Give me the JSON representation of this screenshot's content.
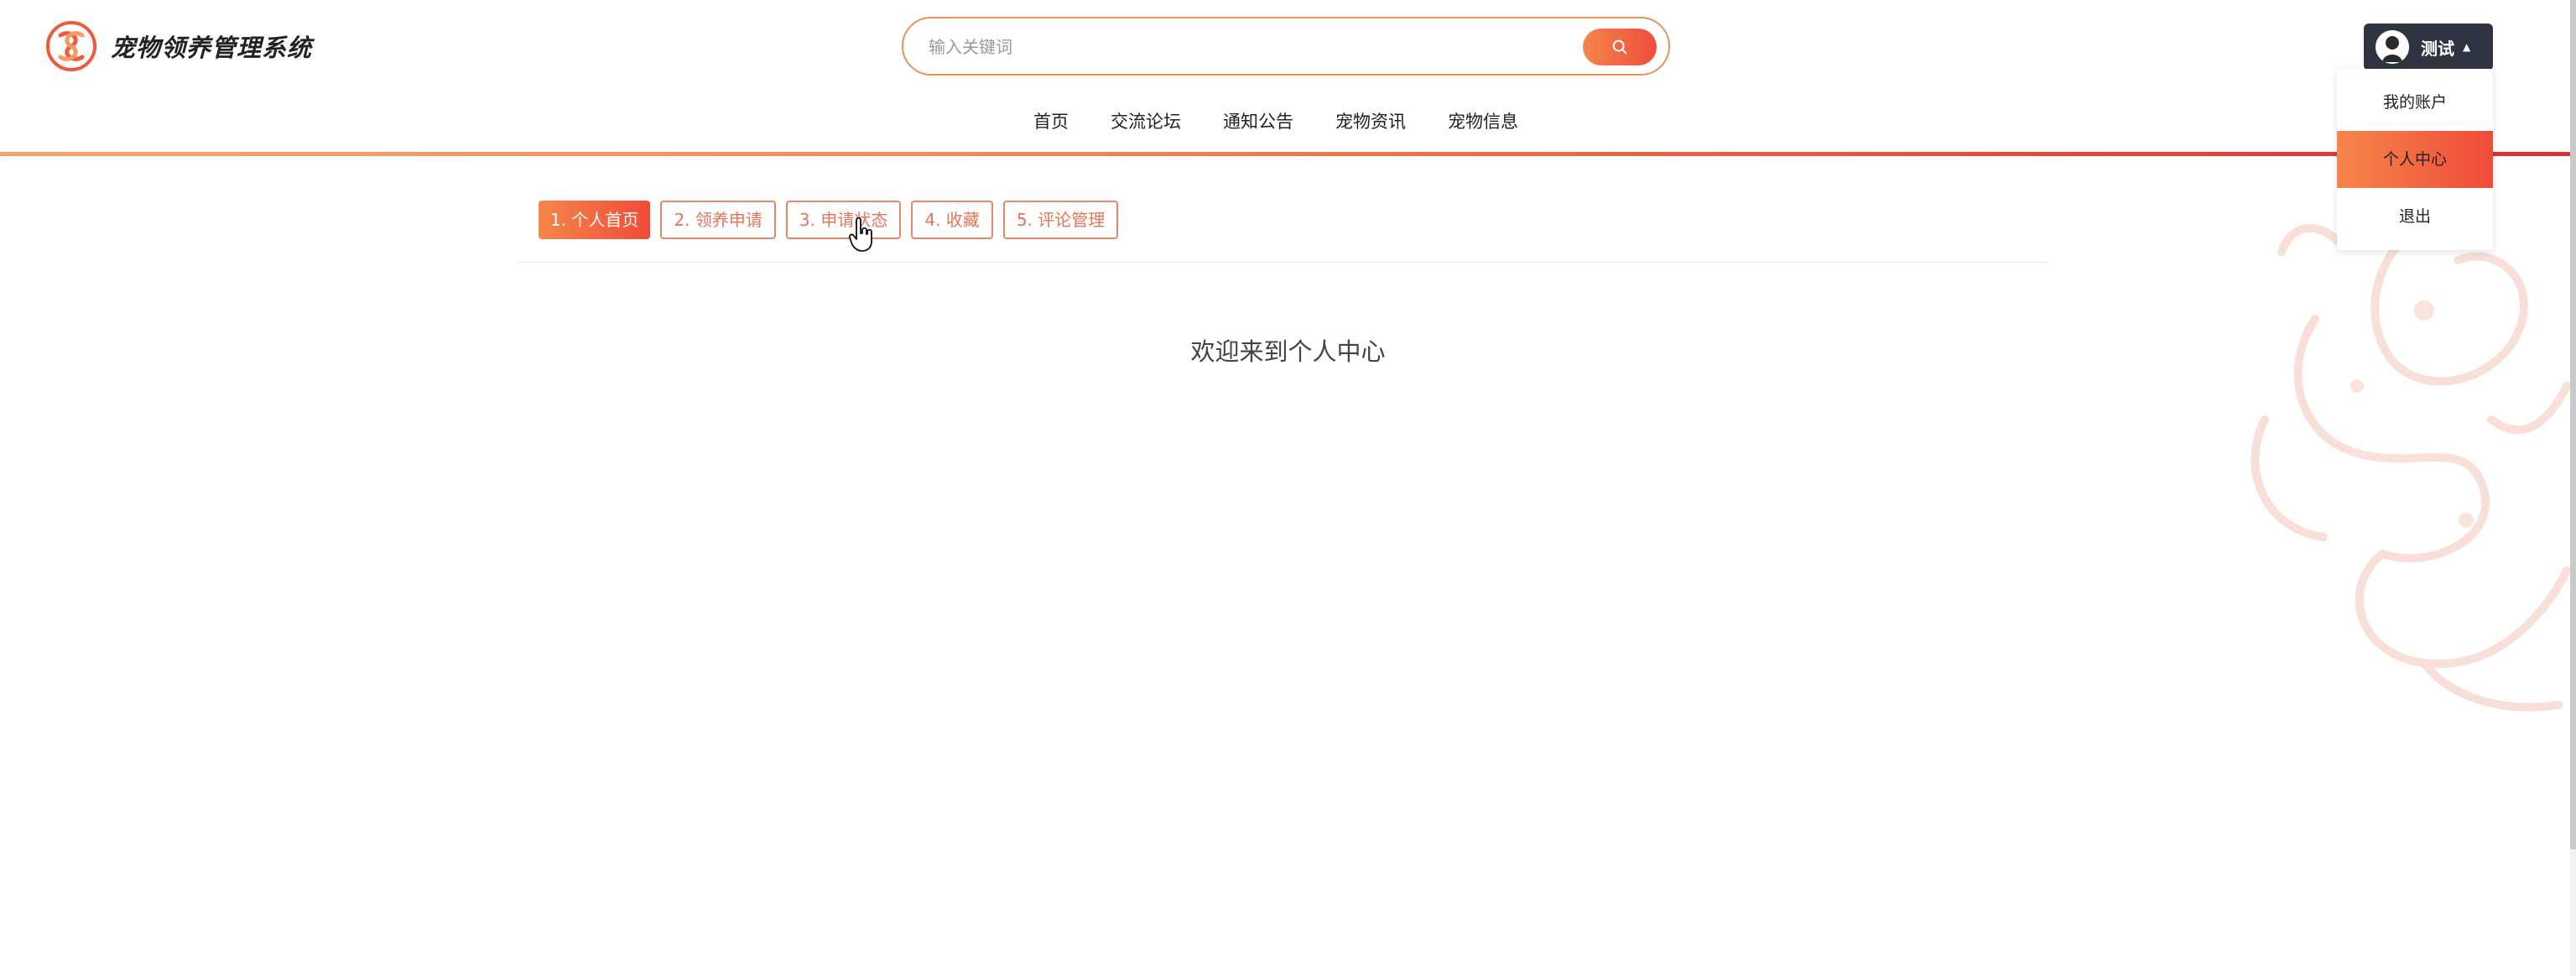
{
  "brand": {
    "title": "宠物领养管理系统",
    "logo_icon": "clover-knot-logo-icon",
    "accent_color": "#ef5a3c"
  },
  "search": {
    "placeholder": "输入关键词",
    "value": "",
    "button_icon": "search-icon"
  },
  "nav": {
    "items": [
      {
        "label": "首页"
      },
      {
        "label": "交流论坛"
      },
      {
        "label": "通知公告"
      },
      {
        "label": "宠物资讯"
      },
      {
        "label": "宠物信息"
      }
    ]
  },
  "user": {
    "name": "测试",
    "avatar_icon": "avatar-icon",
    "menu": [
      {
        "label": "我的账户",
        "active": false
      },
      {
        "label": "个人中心",
        "active": true
      },
      {
        "label": "退出",
        "active": false
      }
    ]
  },
  "tabs": [
    {
      "label": "1. 个人首页",
      "active": true
    },
    {
      "label": "2. 领养申请",
      "active": false
    },
    {
      "label": "3. 申请状态",
      "active": false
    },
    {
      "label": "4. 收藏",
      "active": false
    },
    {
      "label": "5. 评论管理",
      "active": false
    }
  ],
  "main": {
    "welcome": "欢迎来到个人中心"
  },
  "colors": {
    "gradient_start": "#f6864b",
    "gradient_end": "#ef4b38",
    "user_button_bg": "#2f3442",
    "tab_border": "#e9866a"
  }
}
